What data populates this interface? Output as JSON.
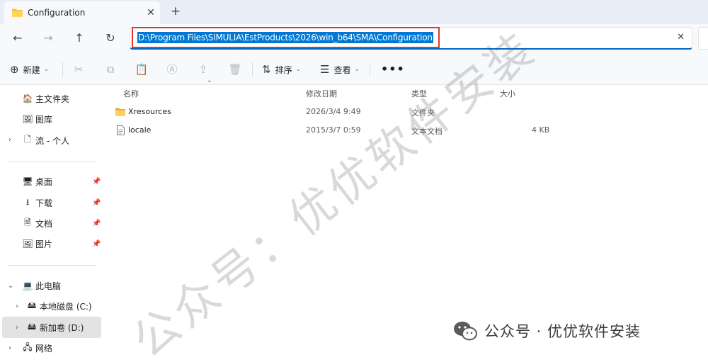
{
  "window": {
    "tab_title": "Configuration",
    "tab_close": "✕",
    "tab_add": "+"
  },
  "nav": {
    "back": "←",
    "forward": "→",
    "up": "↑",
    "refresh": "↻",
    "address": "D:\\Program Files\\SIMULIA\\EstProducts\\2026\\win_b64\\SMA\\Configuration",
    "clear": "✕"
  },
  "toolbar": {
    "new_label": "新建",
    "sort_label": "排序",
    "view_label": "查看",
    "more": "•••"
  },
  "sidebar": {
    "home": "主文件夹",
    "gallery": "图库",
    "onedrive": "流 - 个人",
    "desktop": "桌面",
    "downloads": "下载",
    "documents": "文档",
    "pictures": "图片",
    "this_pc": "此电脑",
    "drive_c": "本地磁盘 (C:)",
    "drive_d": "新加卷 (D:)",
    "network": "网络"
  },
  "list": {
    "columns": [
      "名称",
      "修改日期",
      "类型",
      "大小"
    ],
    "rows": [
      {
        "name": "Xresources",
        "modified": "2026/3/4 9:49",
        "type": "文件夹",
        "size": "",
        "icon": "folder-icon"
      },
      {
        "name": "locale",
        "modified": "2015/3/7 0:59",
        "type": "文本文档",
        "size": "4 KB",
        "icon": "text-file-icon"
      }
    ]
  },
  "watermark": {
    "text": "公众号：优优软件安装",
    "brand": "公众号 · 优优软件安装"
  },
  "colors": {
    "accent": "#0078d4",
    "highlight_box": "#e0352b",
    "folder": "#f5c046",
    "selection": "#e3e3e3"
  }
}
